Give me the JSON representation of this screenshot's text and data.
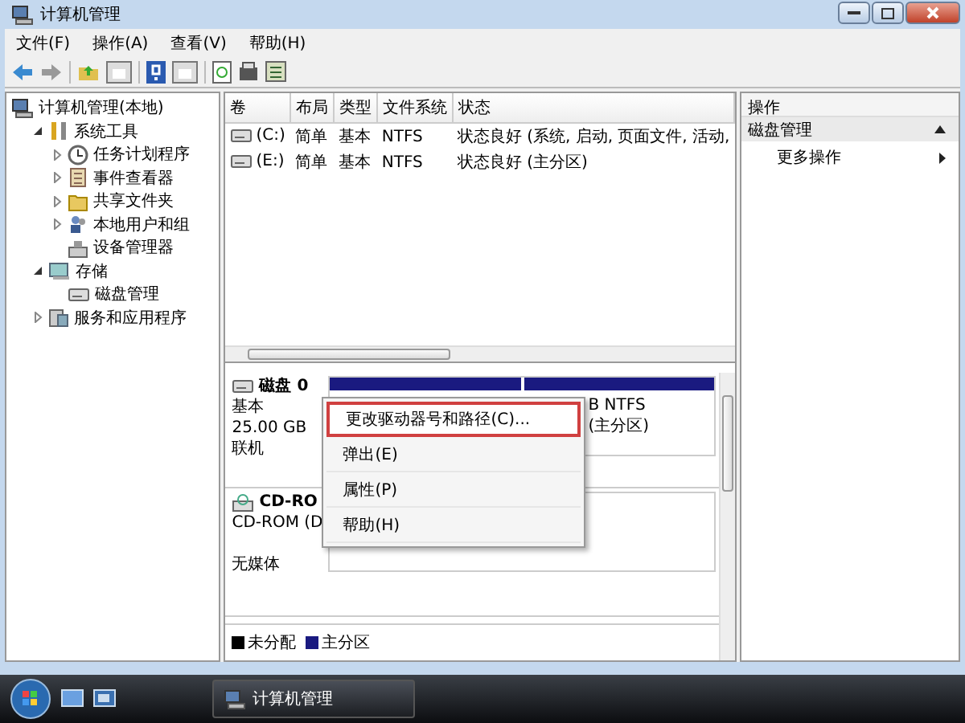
{
  "window": {
    "title": "计算机管理"
  },
  "menu": [
    "文件(F)",
    "操作(A)",
    "查看(V)",
    "帮助(H)"
  ],
  "tree": [
    {
      "label": "计算机管理(本地)",
      "children": [
        {
          "label": "系统工具",
          "expanded": true,
          "children": [
            {
              "label": "任务计划程序",
              "expanded": false
            },
            {
              "label": "事件查看器",
              "expanded": false
            },
            {
              "label": "共享文件夹",
              "expanded": false
            },
            {
              "label": "本地用户和组",
              "expanded": false
            },
            {
              "label": "设备管理器"
            }
          ]
        },
        {
          "label": "存储",
          "expanded": true,
          "children": [
            {
              "label": "磁盘管理"
            }
          ]
        },
        {
          "label": "服务和应用程序",
          "expanded": false
        }
      ]
    }
  ],
  "volumes": {
    "columns": [
      "卷",
      "布局",
      "类型",
      "文件系统",
      "状态"
    ],
    "rows": [
      [
        "(C:)",
        "简单",
        "基本",
        "NTFS",
        "状态良好 (系统, 启动, 页面文件, 活动,"
      ],
      [
        "(E:)",
        "简单",
        "基本",
        "NTFS",
        "状态良好 (主分区)"
      ]
    ]
  },
  "disks": [
    {
      "kind": "disk",
      "name": "磁盘 0",
      "lines": [
        "基本",
        "25.00 GB",
        "联机"
      ],
      "partitions": [
        {
          "kind": "primary"
        },
        {
          "kind": "primary",
          "lines": [
            "B NTFS",
            "(主分区)"
          ]
        }
      ]
    },
    {
      "kind": "cdrom",
      "name": "CD-RO",
      "lines": [
        "CD-ROM (D",
        "无媒体"
      ]
    }
  ],
  "legend": [
    {
      "label": "未分配",
      "color": "#000000"
    },
    {
      "label": "主分区",
      "color": "#1a1a80"
    }
  ],
  "context_menu": [
    {
      "label": "更改驱动器号和路径(C)...",
      "selected": true
    },
    {
      "label": "弹出(E)",
      "selected": false
    },
    {
      "label": "属性(P)",
      "selected": false
    },
    {
      "label": "帮助(H)",
      "selected": false
    }
  ],
  "actions": {
    "header": "操作",
    "section": "磁盘管理",
    "items": [
      "更多操作"
    ]
  },
  "taskbar": {
    "tasks": [
      "计算机管理"
    ]
  }
}
